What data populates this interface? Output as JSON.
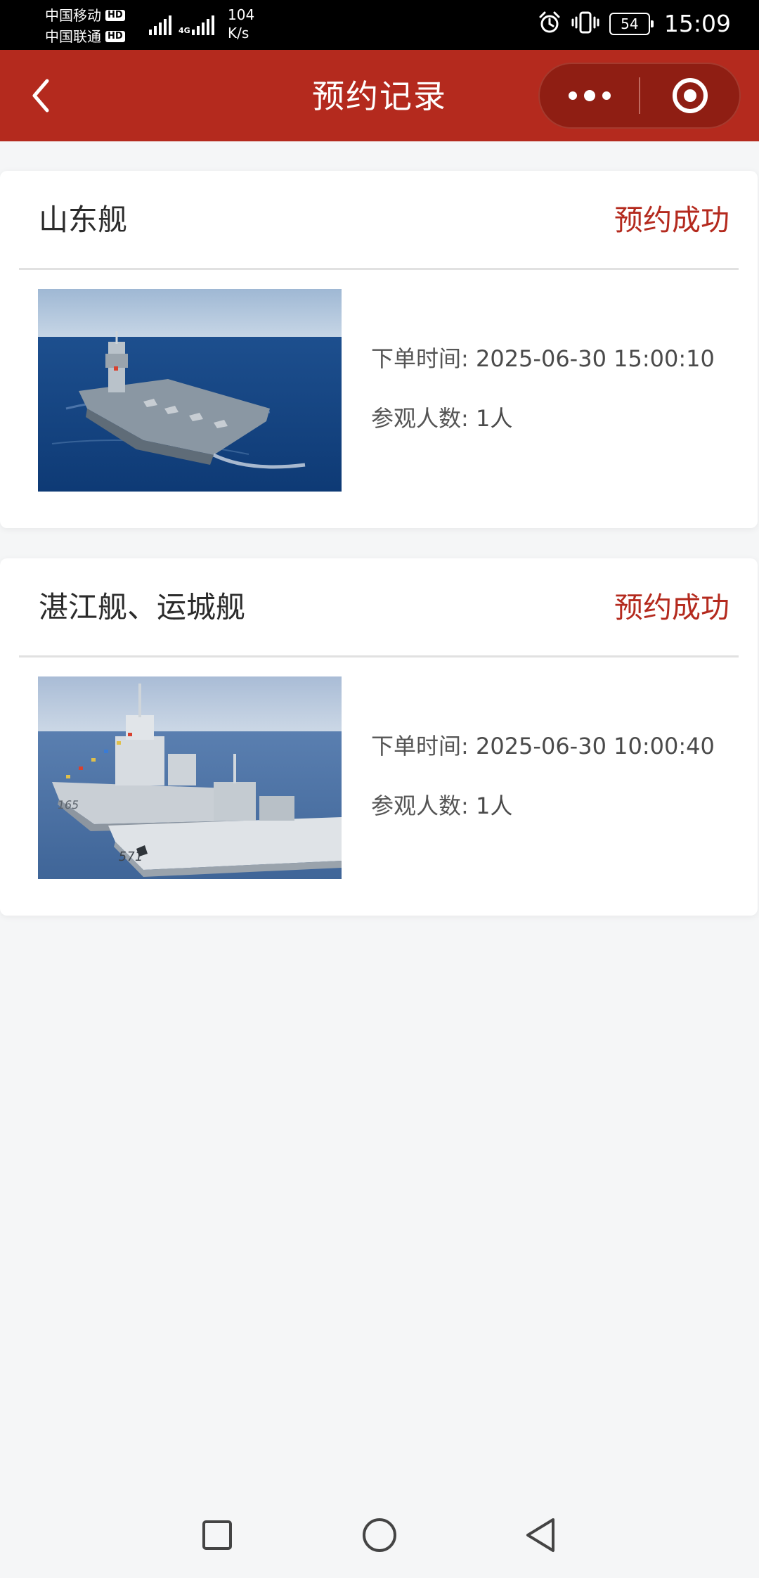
{
  "status_bar": {
    "carrier_1": "中国移动",
    "carrier_2": "中国联通",
    "hd_label": "HD",
    "network_type": "4G",
    "speed_value": "104",
    "speed_unit": "K/s",
    "battery_level": "54",
    "time": "15:09",
    "icons": [
      "alarm-icon",
      "vibrate-icon"
    ]
  },
  "nav": {
    "title": "预约记录",
    "back_icon": "chevron-left-icon",
    "more_icon": "more-dots-icon",
    "close_icon": "target-circle-icon",
    "background_color": "#b42a1e"
  },
  "records": [
    {
      "title": "山东舰",
      "status": "预约成功",
      "order_time_label": "下单时间:",
      "order_time": "2025-06-30 15:00:10",
      "visitors_label": "参观人数:",
      "visitors": "1人",
      "image": "aircraft-carrier-photo"
    },
    {
      "title": "湛江舰、运城舰",
      "status": "预约成功",
      "order_time_label": "下单时间:",
      "order_time": "2025-06-30 10:00:40",
      "visitors_label": "参观人数:",
      "visitors": "1人",
      "image": "warships-photo"
    }
  ],
  "colors": {
    "accent": "#b42a1e",
    "page_background": "#f5f6f7"
  },
  "system_nav": {
    "icons": [
      "recent-apps-icon",
      "home-icon",
      "back-icon"
    ]
  }
}
